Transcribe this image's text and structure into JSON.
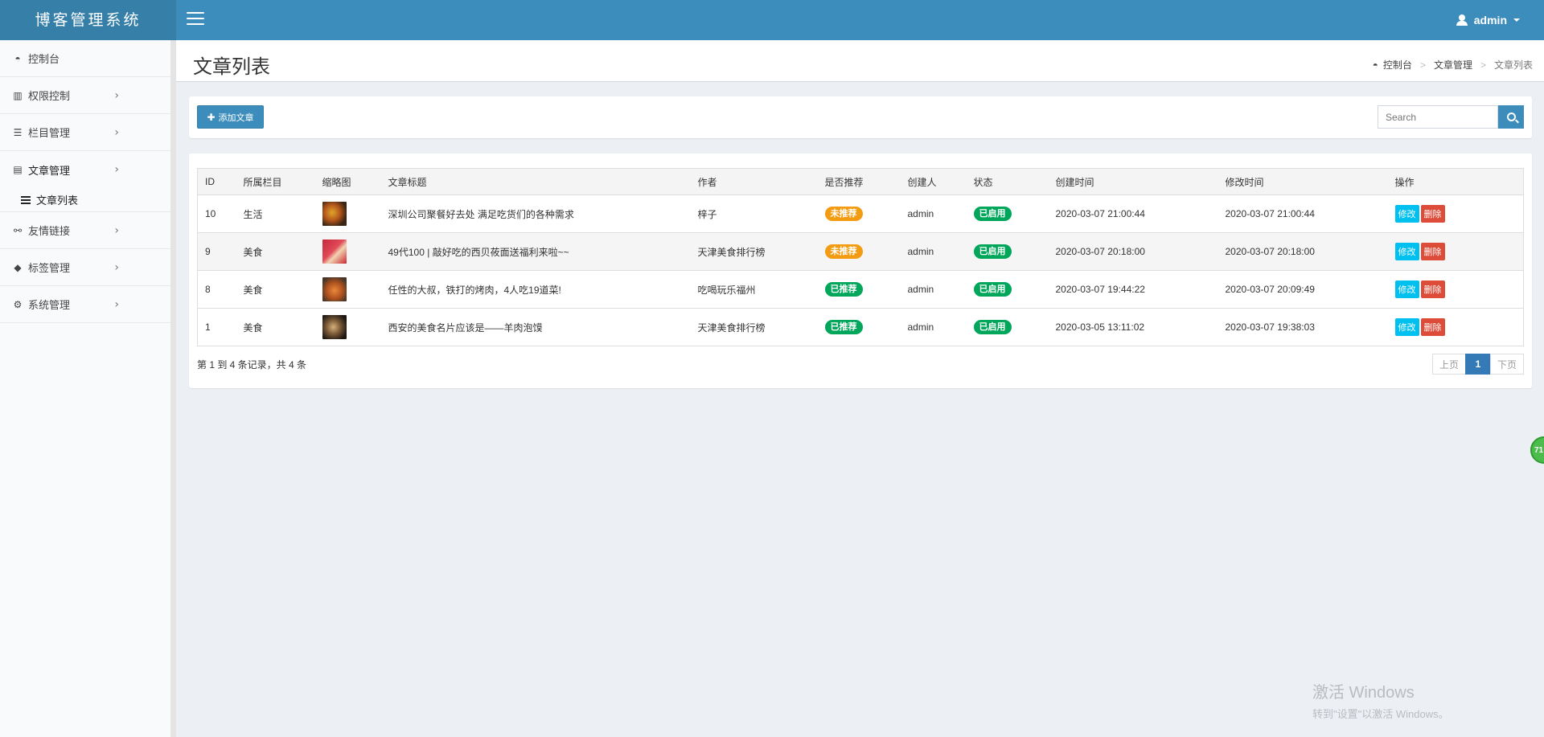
{
  "app": {
    "logo": "博客管理系统"
  },
  "header": {
    "user": "admin"
  },
  "sidebar": {
    "items": [
      {
        "label": "控制台",
        "icon": "dashboard-icon"
      },
      {
        "label": "权限控制",
        "icon": "bar-chart-icon"
      },
      {
        "label": "栏目管理",
        "icon": "list-icon"
      },
      {
        "label": "文章管理",
        "icon": "file-icon"
      },
      {
        "label": "友情链接",
        "icon": "link-icon"
      },
      {
        "label": "标签管理",
        "icon": "tag-icon"
      },
      {
        "label": "系统管理",
        "icon": "gears-icon"
      }
    ],
    "subitem": {
      "label": "文章列表",
      "icon": "list-icon"
    }
  },
  "page": {
    "title": "文章列表"
  },
  "breadcrumb": {
    "home": "控制台",
    "section": "文章管理",
    "current": "文章列表"
  },
  "toolbar": {
    "add_label": "添加文章",
    "search_placeholder": "Search"
  },
  "table": {
    "headers": [
      "ID",
      "所属栏目",
      "缩略图",
      "文章标题",
      "作者",
      "是否推荐",
      "创建人",
      "状态",
      "创建时间",
      "修改时间",
      "操作"
    ],
    "rows": [
      {
        "id": "10",
        "category": "生活",
        "title": "深圳公司聚餐好去处 满足吃货们的各种需求",
        "author": "梓子",
        "recommend": "未推荐",
        "creator": "admin",
        "status": "已启用",
        "created": "2020-03-07 21:00:44",
        "modified": "2020-03-07 21:00:44"
      },
      {
        "id": "9",
        "category": "美食",
        "title": "49代100 | 敲好吃的西贝莜面送福利来啦~~",
        "author": "天津美食排行榜",
        "recommend": "未推荐",
        "creator": "admin",
        "status": "已启用",
        "created": "2020-03-07 20:18:00",
        "modified": "2020-03-07 20:18:00"
      },
      {
        "id": "8",
        "category": "美食",
        "title": "任性的大叔，铁打的烤肉，4人吃19道菜!",
        "author": "吃喝玩乐福州",
        "recommend": "已推荐",
        "creator": "admin",
        "status": "已启用",
        "created": "2020-03-07 19:44:22",
        "modified": "2020-03-07 20:09:49"
      },
      {
        "id": "1",
        "category": "美食",
        "title": "西安的美食名片应该是——羊肉泡馍",
        "author": "天津美食排行榜",
        "recommend": "已推荐",
        "creator": "admin",
        "status": "已启用",
        "created": "2020-03-05 13:11:02",
        "modified": "2020-03-07 19:38:03"
      }
    ],
    "edit_label": "修改",
    "delete_label": "删除"
  },
  "pagination": {
    "summary": "第 1 到 4 条记录，共 4 条",
    "prev": "上页",
    "current": "1",
    "next": "下页"
  },
  "widget": {
    "label": "71"
  },
  "watermark": {
    "title": "激活 Windows",
    "subtitle": "转到\"设置\"以激活 Windows。"
  },
  "colors": {
    "header": "#3c8dbc",
    "logo_bg": "#367fa9",
    "warning": "#f39c12",
    "success": "#00a65a",
    "edit": "#00c0ef",
    "delete": "#dd4b39"
  }
}
